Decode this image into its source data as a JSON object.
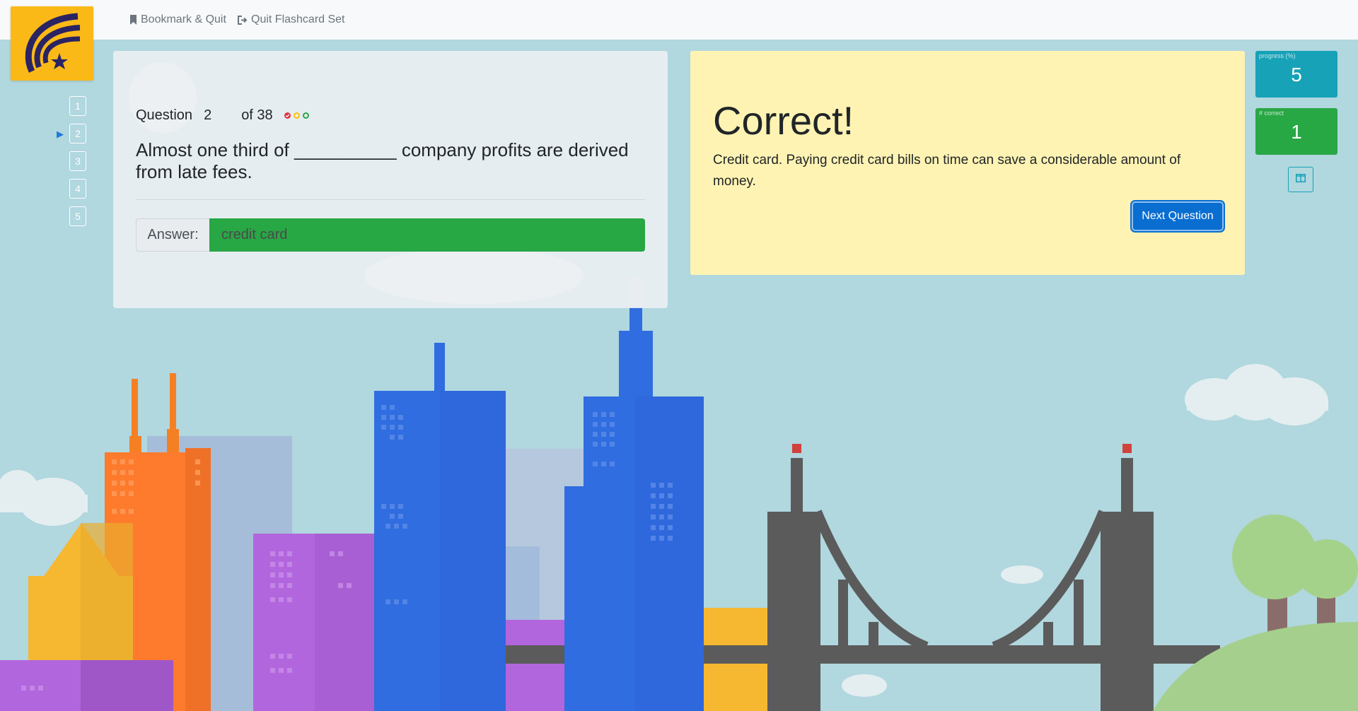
{
  "topbar": {
    "bookmark_quit": "Bookmark & Quit",
    "quit_set": "Quit Flashcard Set"
  },
  "question_nav": {
    "items": [
      "1",
      "2",
      "3",
      "4",
      "5"
    ],
    "current_index": 1
  },
  "question": {
    "label": "Question",
    "number": "2",
    "of_label": "of 38",
    "text": "Almost one third of __________ company profits are derived from late fees.",
    "answer_label": "Answer:",
    "answer_value": "credit card",
    "attempt_dots": [
      {
        "state": "correct",
        "color": "#dc3545"
      },
      {
        "state": "open",
        "color": "#ffc107"
      },
      {
        "state": "open",
        "color": "#28a745"
      }
    ]
  },
  "feedback": {
    "title": "Correct!",
    "text": "Credit card. Paying credit card bills on time can save a considerable amount of money.",
    "next_button": "Next Question"
  },
  "stats": {
    "progress_label": "progress (%)",
    "progress_value": "5",
    "correct_label": "# correct",
    "correct_value": "1",
    "progress_color": "#17a2b8",
    "correct_color": "#28a745"
  },
  "icons": {
    "bookmark": "bookmark-icon",
    "quit": "sign-out-icon",
    "layout": "columns-icon",
    "logo": "brand-logo"
  },
  "colors": {
    "sky": "#b1d7df",
    "logo_bg": "#fbb917",
    "answer_correct": "#28a745",
    "feedback_bg": "#fff3b3",
    "primary": "#0a6ed1"
  }
}
